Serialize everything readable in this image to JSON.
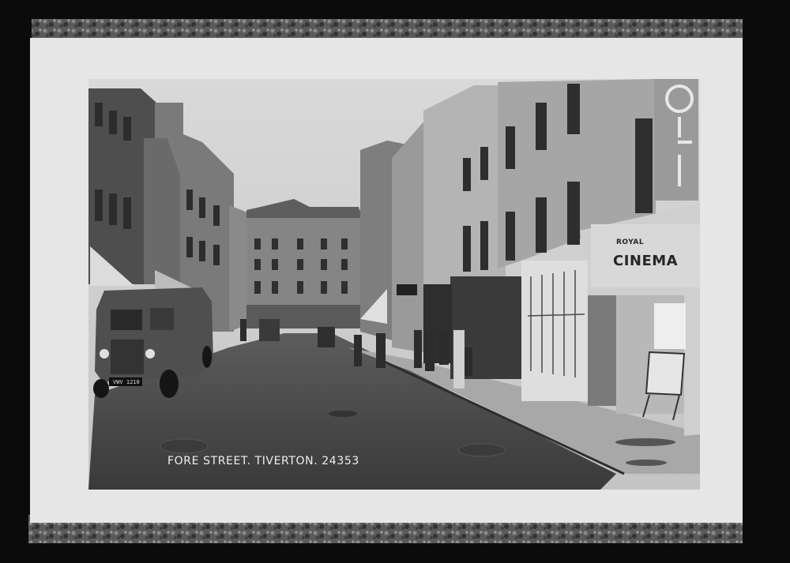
{
  "photo": {
    "caption": "FORE STREET. TIVERTON. 24353",
    "cinema_sign": {
      "top_line": "ROYAL",
      "main_line": "CINEMA"
    },
    "van_plate": "VWV 1210"
  },
  "colors": {
    "frame": "#0b0b0b",
    "mount": "#e6e6e6",
    "sky": "#cfcfcf",
    "road": "#474747",
    "pavement": "#a8a8a8",
    "caption_text": "#efefef"
  }
}
